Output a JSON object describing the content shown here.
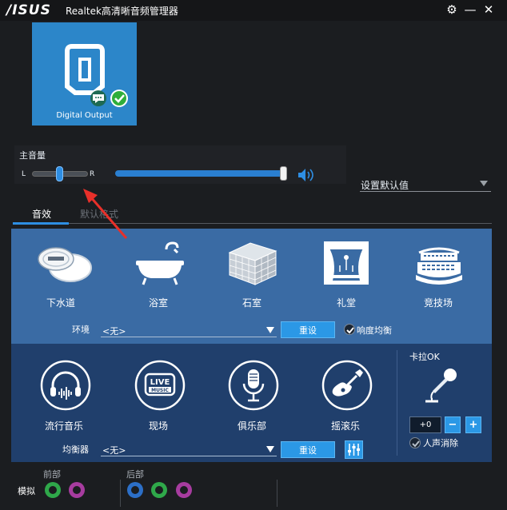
{
  "app": {
    "logo": "/ISUS",
    "title": "Realtek高清晰音频管理器",
    "settings_glyph": "⚙",
    "minimize_glyph": "—",
    "close_glyph": "✕"
  },
  "device": {
    "label": "Digital Output",
    "accent": "#2c86c9"
  },
  "volume": {
    "title": "主音量",
    "left_label": "L",
    "right_label": "R",
    "balance": 0.5,
    "level": 0.97
  },
  "default_setting": {
    "value": "设置默认值"
  },
  "tabs": [
    {
      "label": "音效",
      "active": true
    },
    {
      "label": "默认格式",
      "active": false
    }
  ],
  "environment": {
    "items": [
      "下水道",
      "浴室",
      "石室",
      "礼堂",
      "竞技场"
    ],
    "label": "环境",
    "selected": "<无>",
    "reset_label": "重设",
    "loudness_label": "响度均衡",
    "loudness_checked": true
  },
  "equalizer": {
    "items": [
      "流行音乐",
      "现场",
      "俱乐部",
      "摇滚乐"
    ],
    "live_text": "LIVE",
    "music_text": "MUSIC",
    "label": "均衡器",
    "selected": "<无>",
    "reset_label": "重设"
  },
  "karaoke": {
    "title": "卡拉OK",
    "value": "+0",
    "minus": "−",
    "plus": "+",
    "vocal_cancel_label": "人声消除",
    "vocal_cancel_checked": true
  },
  "connectors": {
    "front_label": "前部",
    "rear_label": "后部",
    "analog_label": "模拟",
    "front_jacks": [
      "#2fa84a",
      "#a73c9f"
    ],
    "rear_jacks": [
      "#2c6fc7",
      "#2fa84a",
      "#a73c9f"
    ]
  }
}
